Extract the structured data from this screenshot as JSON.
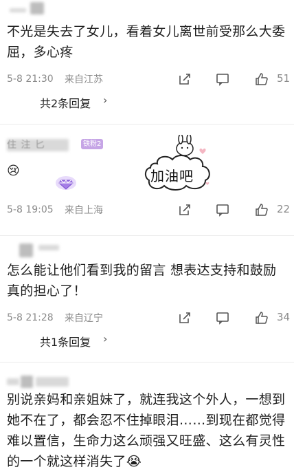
{
  "comments": [
    {
      "text": "不光是失去了女儿，看着女儿离世前受那么大委屈，多心疼",
      "date": "5-8 21:30",
      "location": "来自江苏",
      "likes": "51",
      "replies": "共2条回复"
    },
    {
      "emoji": "😢",
      "badge": "铁粉2",
      "sticker_text": "加油吧",
      "date": "5-8 19:05",
      "location": "来自上海",
      "likes": "22"
    },
    {
      "text": "怎么能让他们看到我的留言 想表达支持和鼓励 真的担心了！",
      "date": "5-8 21:28",
      "location": "来自辽宁",
      "likes": "34",
      "replies": "共1条回复"
    },
    {
      "text": "别说亲妈和亲姐妹了，就连我这个外人，一想到她不在了，都会忍不住掉眼泪……到现在都觉得难以置信，生命力这么顽强又旺盛、这么有灵性的一个就这样消失了😭"
    }
  ],
  "icons": {
    "share": "share-icon",
    "reply": "comment-icon",
    "like": "thumbs-up-icon",
    "chevron": "chevron-right-icon"
  },
  "colors": {
    "meta_gray": "#8a8a8a",
    "divider": "#ececec"
  }
}
